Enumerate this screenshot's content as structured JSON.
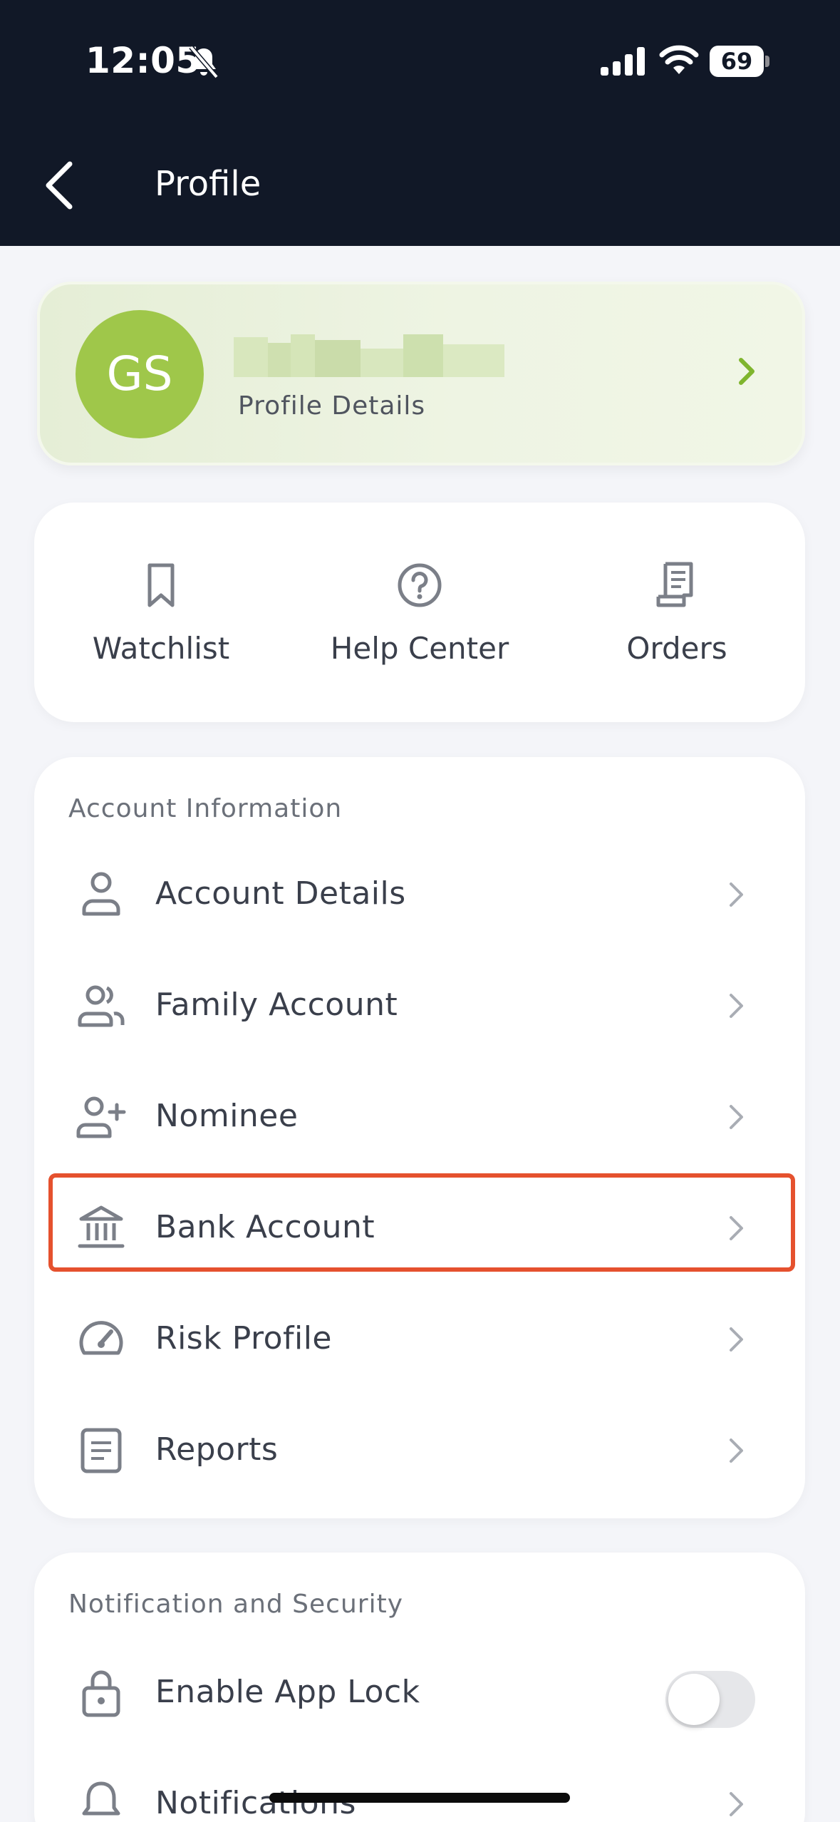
{
  "status_bar": {
    "time": "12:05",
    "battery": "69"
  },
  "header": {
    "title": "Profile"
  },
  "profile": {
    "initials": "GS",
    "subtitle": "Profile Details"
  },
  "quick_actions": [
    {
      "label": "Watchlist",
      "icon": "bookmark-icon"
    },
    {
      "label": "Help Center",
      "icon": "help-circle-icon"
    },
    {
      "label": "Orders",
      "icon": "receipt-icon"
    }
  ],
  "account_section": {
    "title": "Account Information",
    "items": [
      {
        "label": "Account Details",
        "icon": "user-icon"
      },
      {
        "label": "Family Account",
        "icon": "users-icon"
      },
      {
        "label": "Nominee",
        "icon": "user-plus-icon"
      },
      {
        "label": "Bank Account",
        "icon": "bank-icon"
      },
      {
        "label": "Risk Profile",
        "icon": "gauge-icon"
      },
      {
        "label": "Reports",
        "icon": "document-icon"
      }
    ]
  },
  "notification_section": {
    "title": "Notification and Security",
    "items": [
      {
        "label": "Enable App Lock",
        "icon": "lock-icon",
        "toggle_on": false
      },
      {
        "label": "Notifications",
        "icon": "bell-icon"
      }
    ]
  },
  "colors": {
    "header_bg": "#111827",
    "avatar_bg": "#9fc74a",
    "accent_green": "#7fb52e",
    "highlight_border": "#e5512e"
  }
}
